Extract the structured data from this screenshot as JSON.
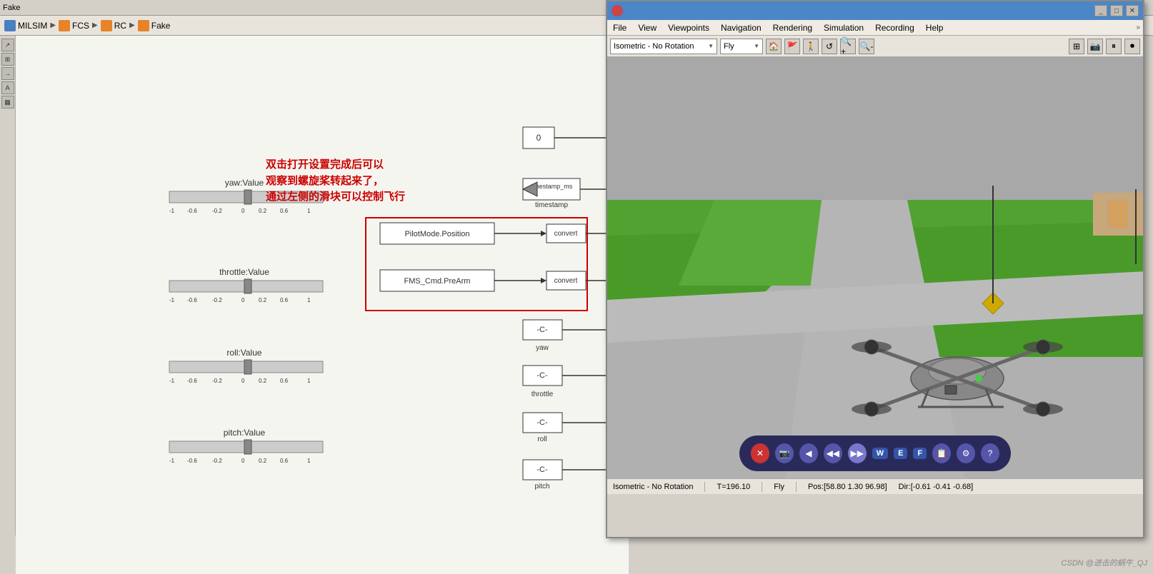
{
  "titlebar": {
    "label": "Fake"
  },
  "breadcrumb": {
    "items": [
      {
        "label": "MILSIM",
        "icon": "blue"
      },
      {
        "label": "FCS",
        "icon": "orange"
      },
      {
        "label": "RC",
        "icon": "orange"
      },
      {
        "label": "Fake",
        "icon": "orange"
      }
    ],
    "arrows": [
      "▶",
      "▶",
      "▶"
    ]
  },
  "annotation": {
    "line1": "双击打开设置完成后可以",
    "line2": "观察到螺旋桨转起来了，",
    "line3": "通过左侧的滑块可以控制飞行"
  },
  "sliders": [
    {
      "id": "yaw",
      "label": "yaw:Value",
      "value": 0
    },
    {
      "id": "throttle",
      "label": "throttle:Value",
      "value": 0
    },
    {
      "id": "roll",
      "label": "roll:Value",
      "value": 0
    },
    {
      "id": "pitch",
      "label": "pitch:Value",
      "value": 0
    }
  ],
  "slider_scale": "-1 -0.8 -0.6 -0.4 -0.2 0 0.2 0.4 0.6 0.8 1",
  "sim_blocks": {
    "constant": {
      "label": "0",
      "value": "0"
    },
    "timestamp_ms": {
      "label": "timestamp_ms"
    },
    "timestamp": {
      "label": "timestamp"
    },
    "pilot_mode": {
      "label": "PilotMode.Position"
    },
    "fms_cmd": {
      "label": "FMS_Cmd.PreArm"
    },
    "convert1": {
      "label": "convert"
    },
    "convert2": {
      "label": "convert"
    },
    "yaw_c": {
      "label": "-C-",
      "sublabel": "yaw"
    },
    "throttle_c": {
      "label": "-C-",
      "sublabel": "throttle"
    },
    "roll_c": {
      "label": "-C-",
      "sublabel": "roll"
    },
    "pitch_c": {
      "label": "-C-",
      "sublabel": "pitch"
    }
  },
  "viewer": {
    "title": "",
    "menus": [
      "File",
      "View",
      "Viewpoints",
      "Navigation",
      "Rendering",
      "Simulation",
      "Recording",
      "Help"
    ],
    "viewpoint_dropdown": "Isometric - No Rotation",
    "fly_dropdown": "Fly",
    "statusbar": {
      "viewpoint": "Isometric - No Rotation",
      "time": "T=196.10",
      "mode": "Fly",
      "position": "Pos:[58.80 1.30 96.98]",
      "direction": "Dir:[-0.61 -0.41 -0.68]"
    },
    "nav_buttons": [
      "✕",
      "📷",
      "◀",
      "◀◀",
      "▶▶",
      "W",
      "E",
      "F",
      "📋",
      "⚙",
      "?"
    ]
  },
  "watermark": "CSDN @进击的蜗牛_QJ"
}
